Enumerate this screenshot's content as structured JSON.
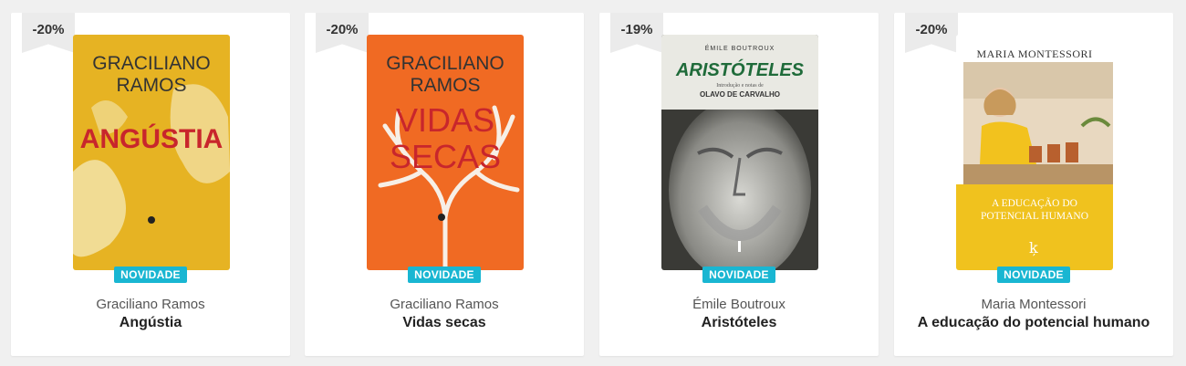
{
  "products": [
    {
      "discount": "-20%",
      "tag": "NOVIDADE",
      "author": "Graciliano Ramos",
      "title": "Angústia",
      "cover": {
        "author_line1": "GRACILIANO",
        "author_line2": "RAMOS",
        "title": "ANGÚSTIA"
      }
    },
    {
      "discount": "-20%",
      "tag": "NOVIDADE",
      "author": "Graciliano Ramos",
      "title": "Vidas secas",
      "cover": {
        "author_line1": "GRACILIANO",
        "author_line2": "RAMOS",
        "title_line1": "VIDAS",
        "title_line2": "SECAS"
      }
    },
    {
      "discount": "-19%",
      "tag": "NOVIDADE",
      "author": "Émile Boutroux",
      "title": "Aristóteles",
      "cover": {
        "author": "ÉMILE BOUTROUX",
        "title": "ARISTÓTELES",
        "subtitle": "Introdução e notas de",
        "editor": "OLAVO DE CARVALHO"
      }
    },
    {
      "discount": "-20%",
      "tag": "NOVIDADE",
      "author": "Maria Montessori",
      "title": "A educação do potencial humano",
      "cover": {
        "author": "MARIA MONTESSORI",
        "title_line1": "A EDUCAÇÃO DO",
        "title_line2": "POTENCIAL HUMANO"
      }
    }
  ],
  "colors": {
    "badge_bg": "#ebebeb",
    "tag_bg": "#19b6d2",
    "cover1": "#e6b323",
    "cover2": "#f06a23",
    "cover3": "#e9e9e3",
    "cover4": "#f0c21e"
  }
}
